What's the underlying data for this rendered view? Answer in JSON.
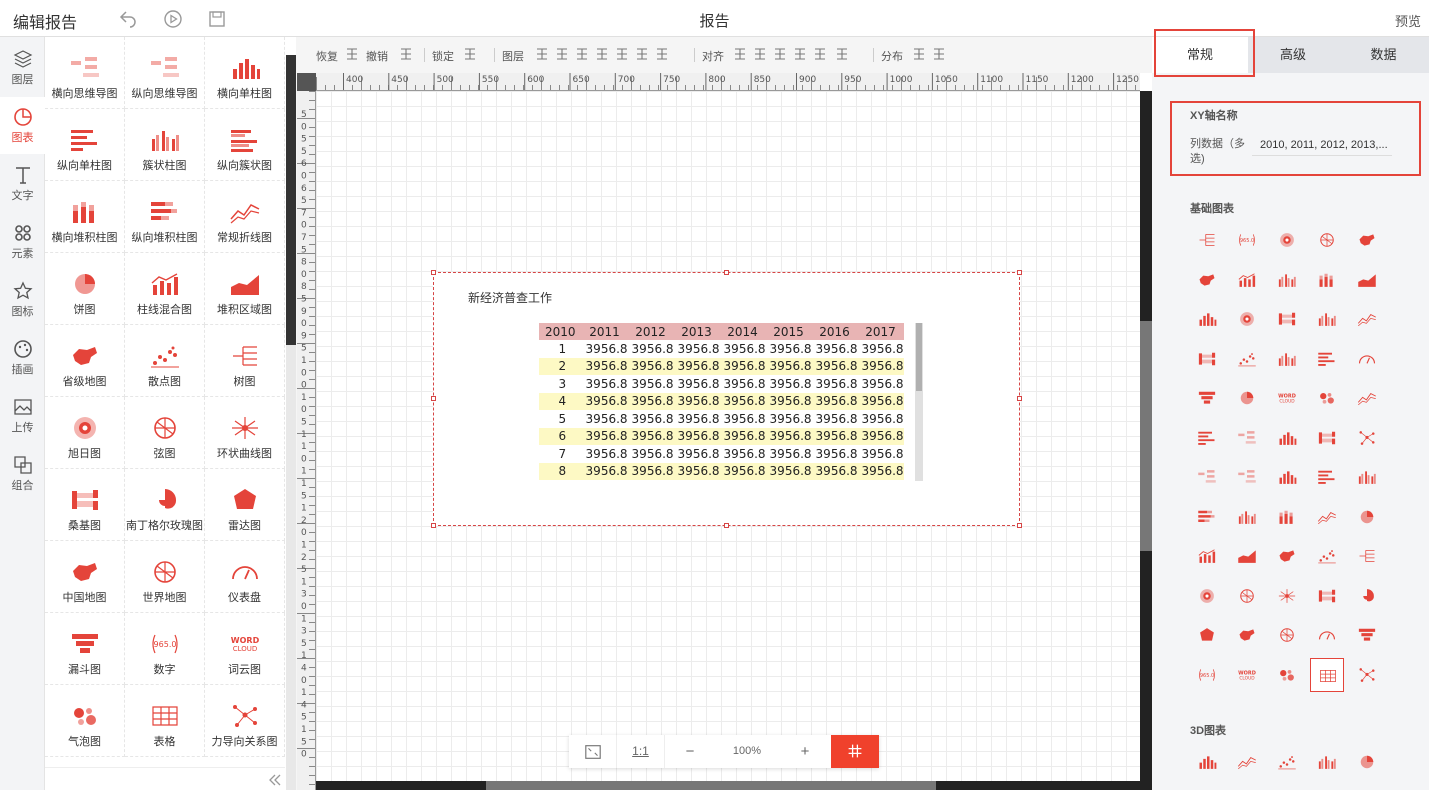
{
  "header": {
    "app_title": "编辑报告",
    "page_title": "报告",
    "preview": "预览"
  },
  "icon_rail": [
    {
      "label": "图层",
      "icon": "layers-icon"
    },
    {
      "label": "图表",
      "icon": "chart-icon",
      "active": true
    },
    {
      "label": "文字",
      "icon": "text-icon"
    },
    {
      "label": "元素",
      "icon": "elements-icon"
    },
    {
      "label": "图标",
      "icon": "star-icon"
    },
    {
      "label": "插画",
      "icon": "palette-icon"
    },
    {
      "label": "上传",
      "icon": "upload-image-icon"
    },
    {
      "label": "组合",
      "icon": "group-icon"
    }
  ],
  "palette": [
    {
      "label": "横向思维导图",
      "icon": "mindmap-h-icon"
    },
    {
      "label": "纵向思维导图",
      "icon": "mindmap-v-icon"
    },
    {
      "label": "横向单柱图",
      "icon": "bar-h-icon"
    },
    {
      "label": "纵向单柱图",
      "icon": "bar-v-icon"
    },
    {
      "label": "簇状柱图",
      "icon": "cluster-bar-icon"
    },
    {
      "label": "纵向簇状图",
      "icon": "cluster-bar-v-icon"
    },
    {
      "label": "横向堆积柱图",
      "icon": "stack-bar-icon"
    },
    {
      "label": "纵向堆积柱图",
      "icon": "stack-bar-v-icon"
    },
    {
      "label": "常规折线图",
      "icon": "line-icon"
    },
    {
      "label": "饼图",
      "icon": "pie-icon"
    },
    {
      "label": "柱线混合图",
      "icon": "bar-line-icon"
    },
    {
      "label": "堆积区域图",
      "icon": "area-icon"
    },
    {
      "label": "省级地图",
      "icon": "province-map-icon"
    },
    {
      "label": "散点图",
      "icon": "scatter-icon"
    },
    {
      "label": "树图",
      "icon": "tree-icon"
    },
    {
      "label": "旭日图",
      "icon": "sunburst-icon"
    },
    {
      "label": "弦图",
      "icon": "chord-icon"
    },
    {
      "label": "环状曲线图",
      "icon": "ring-curve-icon"
    },
    {
      "label": "桑基图",
      "icon": "sankey-icon"
    },
    {
      "label": "南丁格尔玫瑰图",
      "icon": "rose-icon"
    },
    {
      "label": "雷达图",
      "icon": "radar-icon"
    },
    {
      "label": "中国地图",
      "icon": "china-map-icon"
    },
    {
      "label": "世界地图",
      "icon": "world-map-icon"
    },
    {
      "label": "仪表盘",
      "icon": "gauge-icon"
    },
    {
      "label": "漏斗图",
      "icon": "funnel-icon"
    },
    {
      "label": "数字",
      "icon": "number-icon"
    },
    {
      "label": "词云图",
      "icon": "wordcloud-icon"
    },
    {
      "label": "气泡图",
      "icon": "bubble-icon"
    },
    {
      "label": "表格",
      "icon": "table-icon"
    },
    {
      "label": "力导向关系图",
      "icon": "force-graph-icon"
    }
  ],
  "palette_icon_text": {
    "number": "965.0",
    "word": "WORD",
    "cloud": "CLOUD"
  },
  "toolbar": {
    "redo": "恢复",
    "undo": "撤销",
    "lock": "锁定",
    "layer": "图层",
    "align": "对齐",
    "distribute": "分布"
  },
  "ruler_h": [
    "400",
    "450",
    "500",
    "550",
    "600",
    "650",
    "700",
    "750",
    "800",
    "850",
    "900",
    "950",
    "1000",
    "1050",
    "1100",
    "1150",
    "1200",
    "1250"
  ],
  "ruler_v": [
    "5",
    "0",
    "5",
    "5",
    "6",
    "0",
    "6",
    "5",
    "7",
    "0",
    "7",
    "5",
    "8",
    "0",
    "8",
    "5",
    "9",
    "0",
    "9",
    "5",
    "1",
    "0",
    "0",
    "1",
    "0",
    "5",
    "1",
    "1",
    "0",
    "1",
    "1",
    "5",
    "1",
    "2",
    "0",
    "1",
    "2",
    "5",
    "1",
    "3",
    "0",
    "1",
    "3",
    "5",
    "1",
    "4",
    "0",
    "1",
    "4",
    "5",
    "1",
    "5",
    "0"
  ],
  "widget": {
    "title": "新经济普查工作",
    "table": {
      "headers": [
        "2010",
        "2011",
        "2012",
        "2013",
        "2014",
        "2015",
        "2016",
        "2017"
      ],
      "rows": [
        [
          "1",
          "3956.8",
          "3956.8",
          "3956.8",
          "3956.8",
          "3956.8",
          "3956.8",
          "3956.8"
        ],
        [
          "2",
          "3956.8",
          "3956.8",
          "3956.8",
          "3956.8",
          "3956.8",
          "3956.8",
          "3956.8"
        ],
        [
          "3",
          "3956.8",
          "3956.8",
          "3956.8",
          "3956.8",
          "3956.8",
          "3956.8",
          "3956.8"
        ],
        [
          "4",
          "3956.8",
          "3956.8",
          "3956.8",
          "3956.8",
          "3956.8",
          "3956.8",
          "3956.8"
        ],
        [
          "5",
          "3956.8",
          "3956.8",
          "3956.8",
          "3956.8",
          "3956.8",
          "3956.8",
          "3956.8"
        ],
        [
          "6",
          "3956.8",
          "3956.8",
          "3956.8",
          "3956.8",
          "3956.8",
          "3956.8",
          "3956.8"
        ],
        [
          "7",
          "3956.8",
          "3956.8",
          "3956.8",
          "3956.8",
          "3956.8",
          "3956.8",
          "3956.8"
        ],
        [
          "8",
          "3956.8",
          "3956.8",
          "3956.8",
          "3956.8",
          "3956.8",
          "3956.8",
          "3956.8"
        ]
      ]
    }
  },
  "zoom": {
    "ratio": "1:1",
    "minus": "−",
    "level": "100%",
    "plus": "+"
  },
  "panel": {
    "tabs": [
      "常规",
      "高级",
      "数据"
    ],
    "active_tab": "常规",
    "axis_section": "XY轴名称",
    "axis_field_label": "列数据（多选)",
    "axis_field_value": "2010, 2011, 2012, 2013,...",
    "basic_charts": "基础图表",
    "charts_3d": "3D图表"
  },
  "colors": {
    "accent": "#e4443a",
    "header_cell": "#e8b4b4",
    "row_highlight": "#fdf9c4",
    "grid_button": "#f0412c"
  }
}
